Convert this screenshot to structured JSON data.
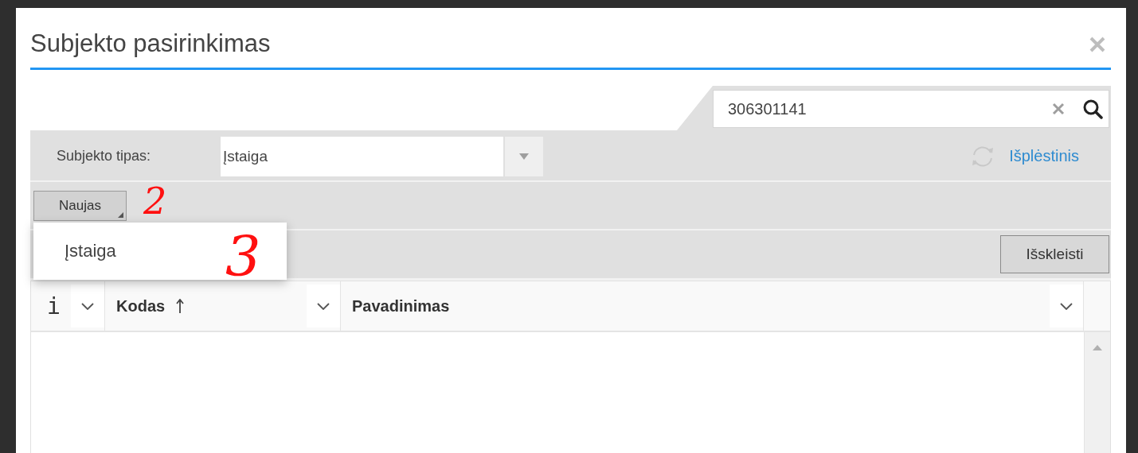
{
  "dialog": {
    "title": "Subjekto pasirinkimas"
  },
  "search": {
    "value": "306301141"
  },
  "filter": {
    "label": "Subjekto tipas:",
    "value": "Įstaiga",
    "advanced_link": "Išplėstinis"
  },
  "toolbar": {
    "new_button": "Naujas",
    "expanded": true
  },
  "menu": {
    "items": [
      {
        "label": "Įstaiga"
      }
    ]
  },
  "grid": {
    "expand_button": "Išskleisti",
    "columns": [
      {
        "label": "i",
        "kind": "info",
        "sorted": false
      },
      {
        "label": "Kodas",
        "kind": "text",
        "sorted": true
      },
      {
        "label": "Pavadinimas",
        "kind": "text",
        "sorted": false
      }
    ]
  },
  "annotations": [
    {
      "text": "2"
    },
    {
      "text": "3"
    }
  ]
}
